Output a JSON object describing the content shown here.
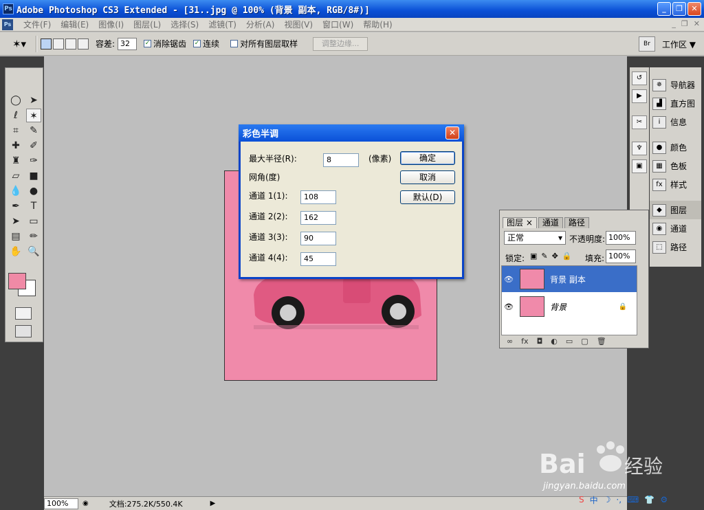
{
  "window": {
    "title": "Adobe Photoshop CS3 Extended - [31..jpg @ 100% (背景 副本, RGB/8#)]",
    "app_icon": "Ps",
    "buttons": [
      "_",
      "❐",
      "✕"
    ]
  },
  "menubar": {
    "logo": "Ps",
    "items": [
      "文件(F)",
      "编辑(E)",
      "图像(I)",
      "图层(L)",
      "选择(S)",
      "滤镜(T)",
      "分析(A)",
      "视图(V)",
      "窗口(W)",
      "帮助(H)"
    ],
    "mdi": [
      "_",
      "❐",
      "✕"
    ]
  },
  "options": {
    "tolerance_label": "容差:",
    "tolerance_value": "32",
    "antialias_label": "消除锯齿",
    "contiguous_label": "连续",
    "sample_all_label": "对所有图层取样",
    "refine_label": "调整边缘...",
    "workspace_label": "工作区 ▼",
    "tool_icon": "magic-wand-icon"
  },
  "dialog": {
    "title": "彩色半调",
    "close": "✕",
    "max_radius_label": "最大半径(R):",
    "max_radius_value": "8",
    "unit_label": "(像素)",
    "angle_label": "网角(度)",
    "ch1_label": "通道 1(1):",
    "ch1_value": "108",
    "ch2_label": "通道 2(2):",
    "ch2_value": "162",
    "ch3_label": "通道 3(3):",
    "ch3_value": "90",
    "ch4_label": "通道 4(4):",
    "ch4_value": "45",
    "ok_label": "确定",
    "cancel_label": "取消",
    "default_label": "默认(D)"
  },
  "dock": {
    "items": [
      {
        "label": "导航器",
        "icon": "navigator-icon",
        "glyph": "✵"
      },
      {
        "label": "直方图",
        "icon": "histogram-icon",
        "glyph": "▟"
      },
      {
        "label": "信息",
        "icon": "info-icon",
        "glyph": "i"
      },
      {
        "label": "颜色",
        "icon": "color-icon",
        "glyph": "●"
      },
      {
        "label": "色板",
        "icon": "swatches-icon",
        "glyph": "▦"
      },
      {
        "label": "样式",
        "icon": "styles-icon",
        "glyph": "fx"
      },
      {
        "label": "图层",
        "icon": "layers-icon",
        "glyph": "◆"
      },
      {
        "label": "通道",
        "icon": "channels-icon",
        "glyph": "◉"
      },
      {
        "label": "路径",
        "icon": "paths-icon",
        "glyph": "⬚"
      }
    ]
  },
  "layers": {
    "tabs": [
      "图层 ×",
      "通道",
      "路径"
    ],
    "blend_mode": "正常",
    "opacity_label": "不透明度:",
    "opacity_value": "100%",
    "lock_label": "锁定:",
    "fill_label": "填充:",
    "fill_value": "100%",
    "rows": [
      {
        "name": "背景 副本",
        "selected": true
      },
      {
        "name": "背景",
        "selected": false
      }
    ]
  },
  "status": {
    "zoom": "100%",
    "doc_info": "文档:275.2K/550.4K"
  },
  "watermark": {
    "brand": "Bai du 经验",
    "url": "jingyan.baidu.com"
  },
  "colors": {
    "foreground": "#f08aa6",
    "background": "#ffffff",
    "doc_fill": "#f08aaa",
    "selection": "#3a6ec8"
  }
}
